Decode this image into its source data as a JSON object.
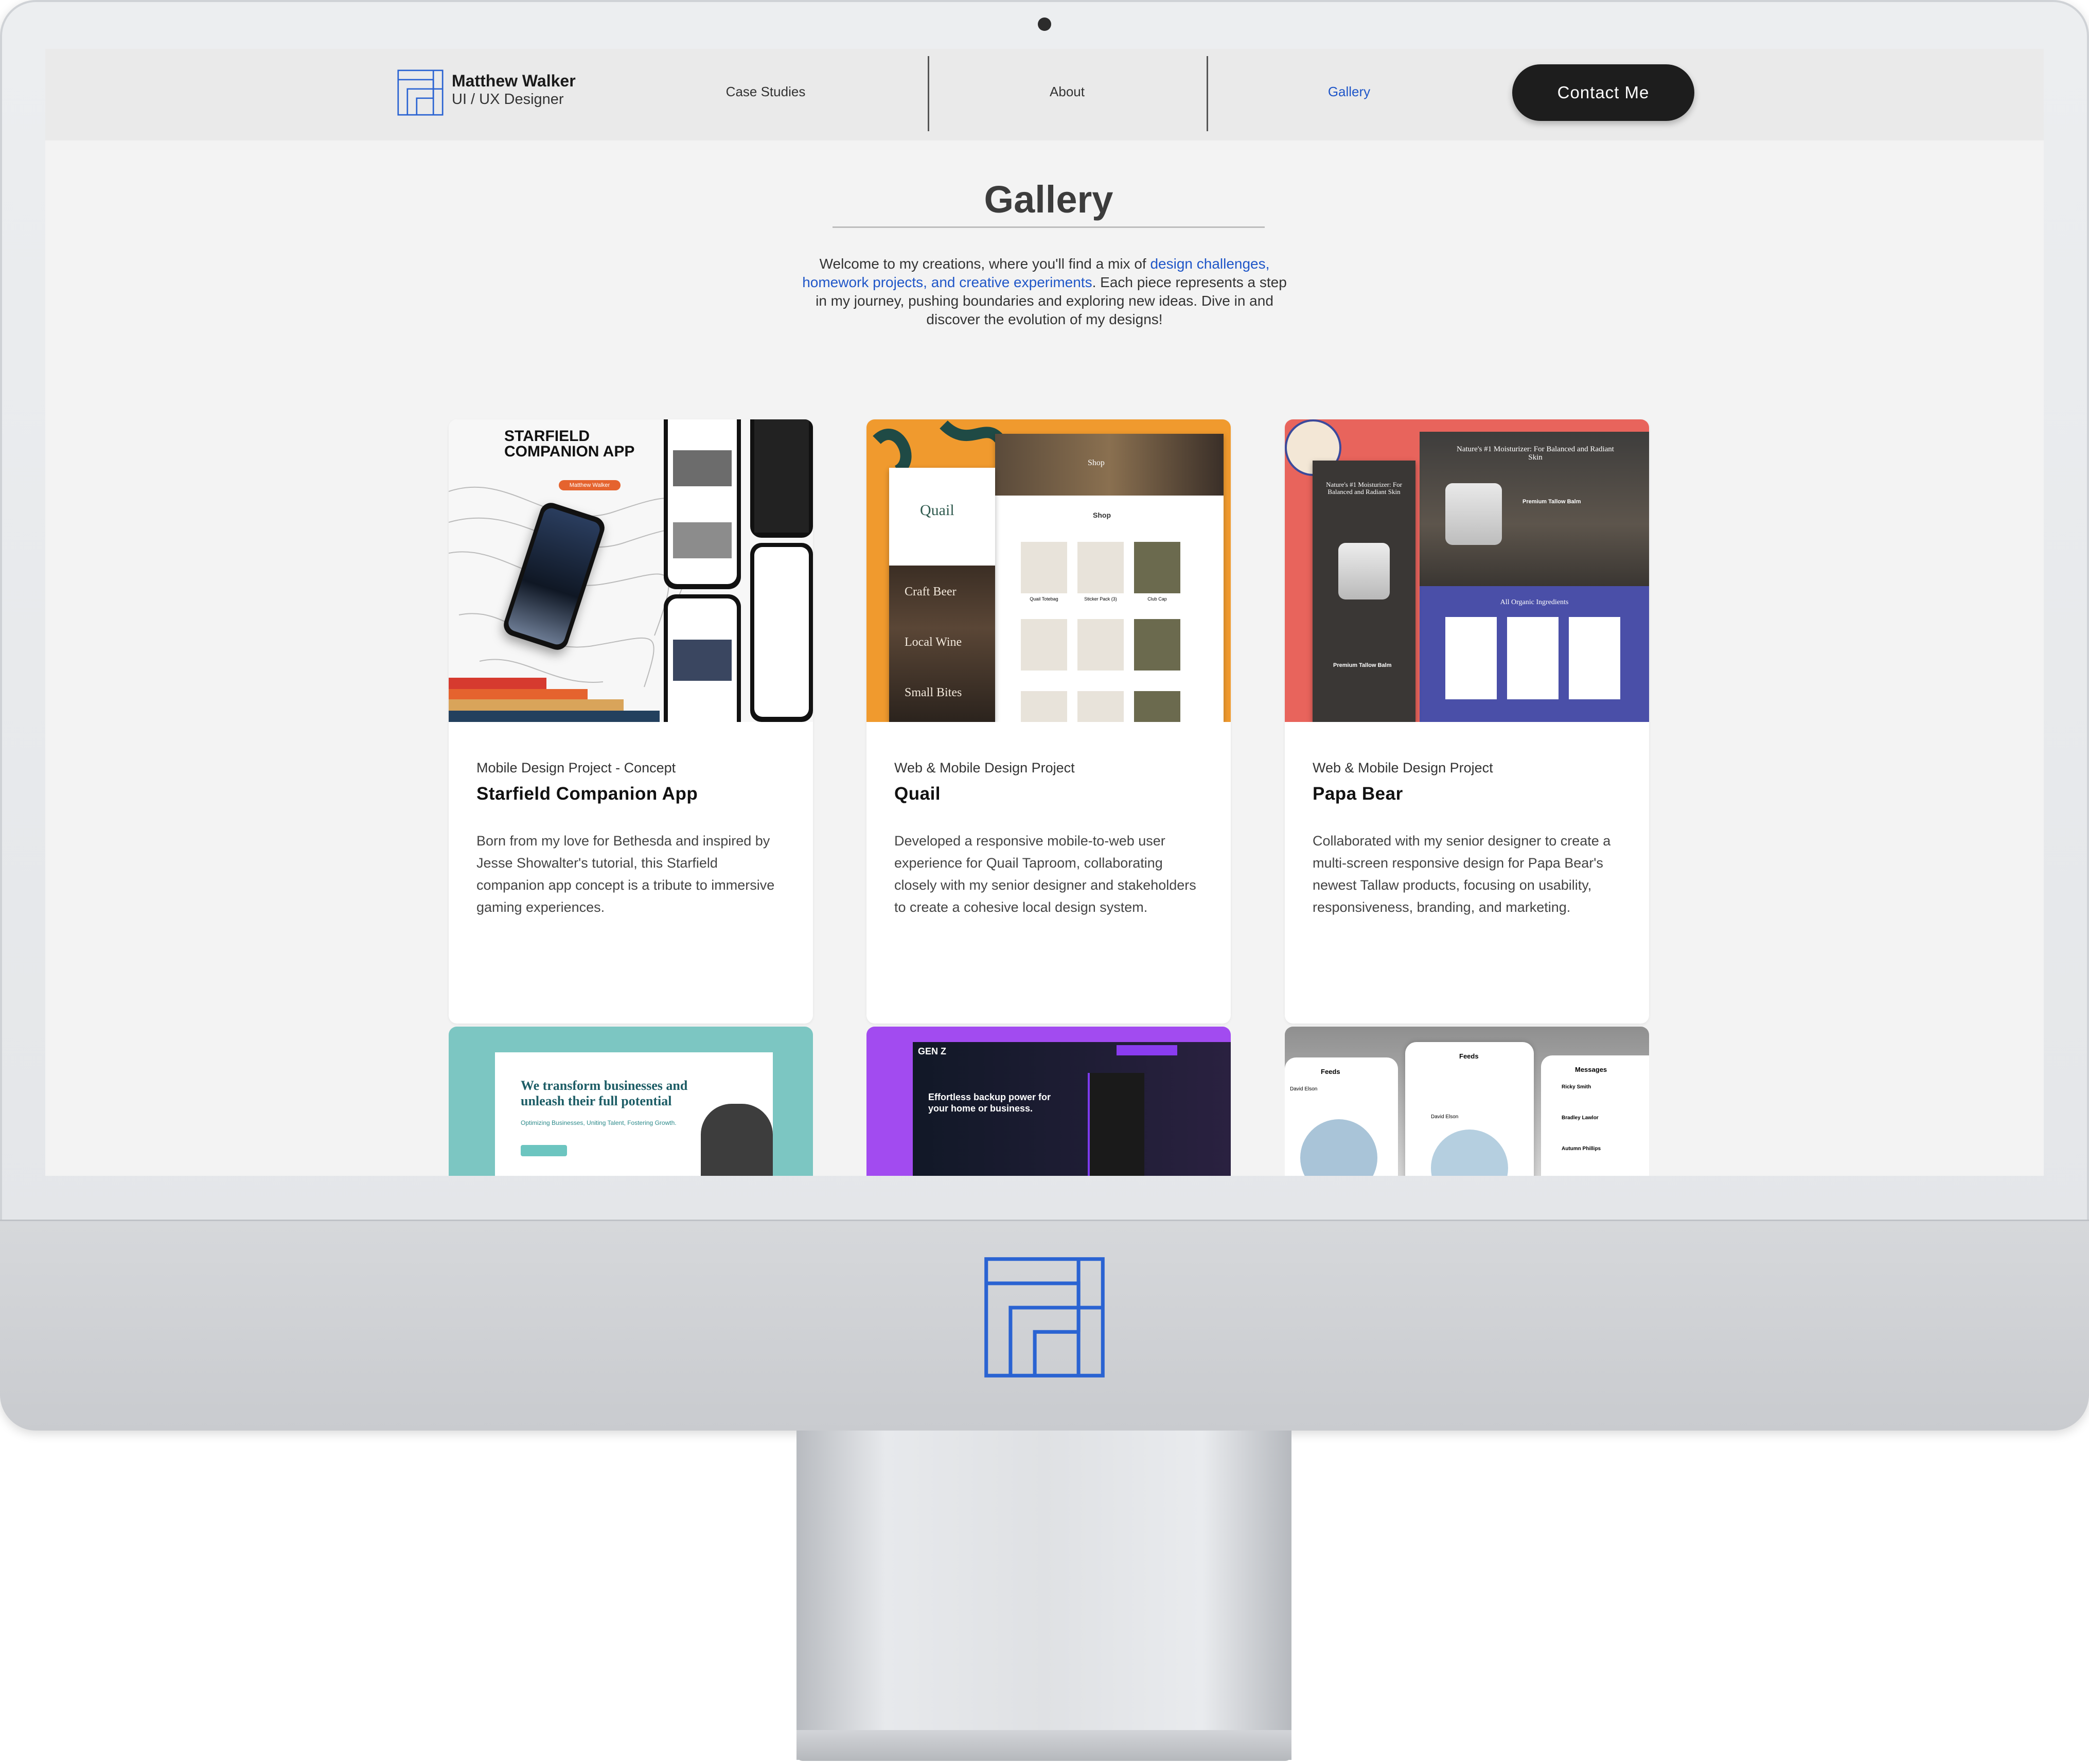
{
  "header": {
    "brand_name": "Matthew Walker",
    "brand_role": "UI / UX Designer",
    "nav": [
      "Case Studies",
      "About",
      "Gallery"
    ],
    "active_nav": "Gallery",
    "contact_label": "Contact Me"
  },
  "main": {
    "title": "Gallery",
    "intro_pre": "Welcome to my creations, where you'll find a mix of ",
    "intro_highlight": "design challenges, homework projects, and creative experiments",
    "intro_post": ". Each piece represents a step in my journey, pushing boundaries and exploring new ideas. Dive in and discover the evolution of my designs!"
  },
  "cards": [
    {
      "category": "Mobile Design Project - Concept",
      "title": "Starfield Companion App",
      "description": "Born from my love for Bethesda and inspired by Jesse Showalter's tutorial, this Starfield companion app concept is a tribute to immersive gaming experiences.",
      "image_title": "STARFIELD COMPANION APP",
      "image_badge": "Matthew Walker"
    },
    {
      "category": "Web & Mobile Design Project",
      "title": "Quail",
      "description": "Developed a responsive mobile-to-web user experience for Quail Taproom, collaborating closely with my senior designer and stakeholders to create a cohesive local design system.",
      "image_brand": "Quail",
      "image_shop": "Shop",
      "image_words": [
        "Craft Beer",
        "Local Wine",
        "Small Bites"
      ],
      "image_items": [
        "Quail Totebag",
        "Sticker Pack (3)",
        "Club Cap"
      ]
    },
    {
      "category": "Web & Mobile Design Project",
      "title": "Papa Bear",
      "description": "Collaborated with my senior designer to create a multi-screen responsive design for Papa Bear's newest Tallaw products, focusing on usability, responsiveness, branding, and marketing.",
      "image_heading": "Nature's #1 Moisturizer: For Balanced and Radiant Skin",
      "image_product": "Premium Tallow Balm",
      "image_section": "All Organic Ingredients"
    }
  ],
  "thumbs": [
    {
      "headline": "We transform businesses and unleash their full potential",
      "tagline": "Optimizing Businesses, Uniting Talent, Fostering Growth."
    },
    {
      "brand": "GEN Z",
      "headline": "Effortless backup power for your home or business."
    },
    {
      "screens": [
        "Feeds",
        "Feeds",
        "Messages"
      ],
      "names": [
        "David Elson",
        "Ricky Smith",
        "Bradley Lawlor",
        "Autumn Phillips"
      ]
    }
  ],
  "colors": {
    "accent": "#1f56c8",
    "contact_button": "#1d1d1d",
    "quail_orange": "#f09a2e",
    "papa_red": "#e8645c",
    "papa_blue": "#4a4fa8",
    "genz_purple": "#a24bf0",
    "teal": "#7cc6c2"
  }
}
